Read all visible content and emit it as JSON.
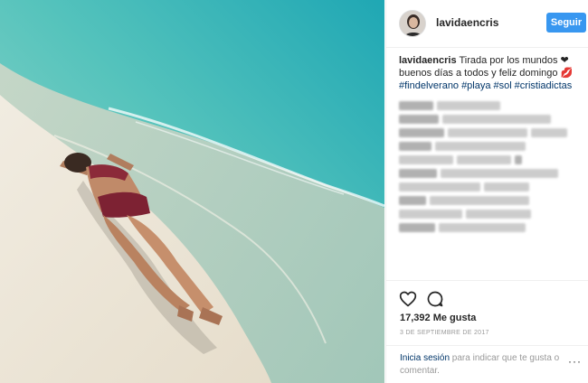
{
  "post": {
    "username": "lavidaencris",
    "follow_label": "Seguir",
    "caption": {
      "username": "lavidaencris",
      "line1": "Tirada por los mundos ❤",
      "line2": "buenos días a todos y feliz domingo 💋",
      "hashtags": [
        "#findelverano",
        "#playa",
        "#sol",
        "#cristiadictas"
      ]
    },
    "likes_text": "17,392 Me gusta",
    "date_text": "3 DE SEPTIEMBRE DE 2017",
    "login": {
      "link_label": "Inicia sesión",
      "rest_text": " para indicar que te gusta o comentar."
    },
    "more_label": "···",
    "icons": {
      "like": "heart-outline-icon",
      "comment": "comment-bubble-icon"
    },
    "colors": {
      "follow_button": "#3897f0",
      "hashtag": "#003569",
      "border": "#efefef"
    }
  }
}
